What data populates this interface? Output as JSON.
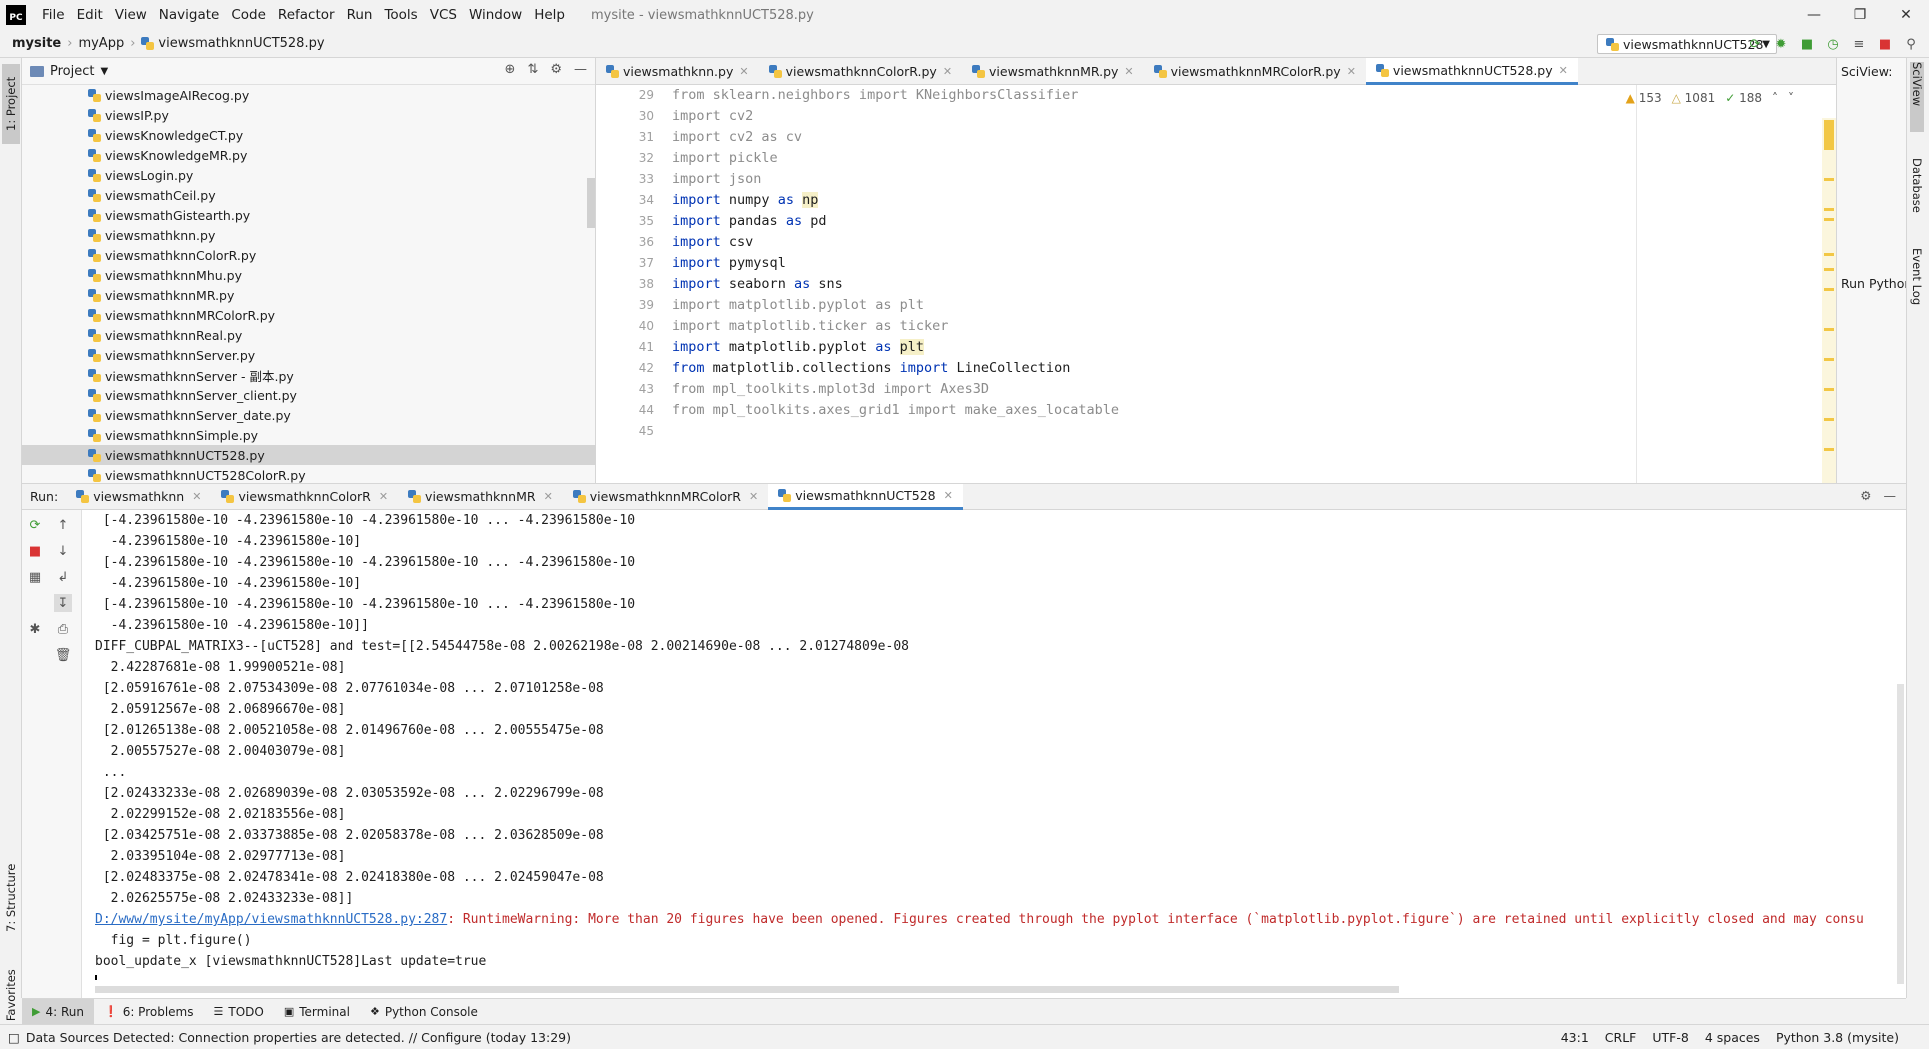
{
  "app": {
    "logo": "PC",
    "window_title": "mysite - viewsmathknnUCT528.py"
  },
  "menu": [
    "File",
    "Edit",
    "View",
    "Navigate",
    "Code",
    "Refactor",
    "Run",
    "Tools",
    "VCS",
    "Window",
    "Help"
  ],
  "breadcrumb": [
    "mysite",
    "myApp",
    "viewsmathknnUCT528.py"
  ],
  "run_config": "viewsmathknnUCT528",
  "left_tabs": {
    "project": "1: Project",
    "structure": "7: Structure",
    "favorites": "2: Favorites"
  },
  "right_tabs": {
    "sciview": "SciView",
    "database": "Database",
    "event_log": "Event Log"
  },
  "project": {
    "title": "Project",
    "files": [
      "viewsImageAIRecog.py",
      "viewsIP.py",
      "viewsKnowledgeCT.py",
      "viewsKnowledgeMR.py",
      "viewsLogin.py",
      "viewsmathCeil.py",
      "viewsmathGistearth.py",
      "viewsmathknn.py",
      "viewsmathknnColorR.py",
      "viewsmathknnMhu.py",
      "viewsmathknnMR.py",
      "viewsmathknnMRColorR.py",
      "viewsmathknnReal.py",
      "viewsmathknnServer.py",
      "viewsmathknnServer - 副本.py",
      "viewsmathknnServer_client.py",
      "viewsmathknnServer_date.py",
      "viewsmathknnSimple.py",
      "viewsmathknnUCT528.py",
      "viewsmathknnUCT528ColorR.py"
    ],
    "selected": "viewsmathknnUCT528.py"
  },
  "editor": {
    "tabs": [
      "viewsmathknn.py",
      "viewsmathknnColorR.py",
      "viewsmathknnMR.py",
      "viewsmathknnMRColorR.py",
      "viewsmathknnUCT528.py"
    ],
    "active_tab": "viewsmathknnUCT528.py",
    "inspection": {
      "warnings": "153",
      "weak_warnings": "1081",
      "typos": "188"
    },
    "lines": [
      {
        "n": "29",
        "t": "from sklearn.neighbors import KNeighborsClassifier"
      },
      {
        "n": "30",
        "t": "import cv2"
      },
      {
        "n": "31",
        "t": "import cv2 as cv"
      },
      {
        "n": "32",
        "t": "import pickle"
      },
      {
        "n": "33",
        "t": "import json"
      },
      {
        "n": "34",
        "t": "import numpy as np"
      },
      {
        "n": "35",
        "t": "import pandas as pd"
      },
      {
        "n": "36",
        "t": "import csv"
      },
      {
        "n": "37",
        "t": "import pymysql"
      },
      {
        "n": "38",
        "t": "import seaborn as sns"
      },
      {
        "n": "39",
        "t": "import matplotlib.pyplot as plt"
      },
      {
        "n": "40",
        "t": "import matplotlib.ticker as ticker"
      },
      {
        "n": "41",
        "t": "import matplotlib.pyplot as plt"
      },
      {
        "n": "42",
        "t": "from matplotlib.collections import LineCollection"
      },
      {
        "n": "43",
        "t": "from mpl_toolkits.mplot3d import Axes3D"
      },
      {
        "n": "44",
        "t": "from mpl_toolkits.axes_grid1 import make_axes_locatable"
      },
      {
        "n": "45",
        "t": ""
      }
    ]
  },
  "sciview": {
    "title": "SciView:",
    "run_label": "Run Python C"
  },
  "run": {
    "label": "Run:",
    "tabs": [
      "viewsmathknn",
      "viewsmathknnColorR",
      "viewsmathknnMR",
      "viewsmathknnMRColorR",
      "viewsmathknnUCT528"
    ],
    "active_tab": "viewsmathknnUCT528",
    "output": [
      " [-4.23961580e-10 -4.23961580e-10 -4.23961580e-10 ... -4.23961580e-10",
      "  -4.23961580e-10 -4.23961580e-10]",
      " [-4.23961580e-10 -4.23961580e-10 -4.23961580e-10 ... -4.23961580e-10",
      "  -4.23961580e-10 -4.23961580e-10]",
      " [-4.23961580e-10 -4.23961580e-10 -4.23961580e-10 ... -4.23961580e-10",
      "  -4.23961580e-10 -4.23961580e-10]]",
      "DIFF_CUBPAL_MATRIX3--[uCT528] and test=[[2.54544758e-08 2.00262198e-08 2.00214690e-08 ... 2.01274809e-08",
      "  2.42287681e-08 1.99900521e-08]",
      " [2.05916761e-08 2.07534309e-08 2.07761034e-08 ... 2.07101258e-08",
      "  2.05912567e-08 2.06896670e-08]",
      " [2.01265138e-08 2.00521058e-08 2.01496760e-08 ... 2.00555475e-08",
      "  2.00557527e-08 2.00403079e-08]",
      " ...",
      " [2.02433233e-08 2.02689039e-08 2.03053592e-08 ... 2.02296799e-08",
      "  2.02299152e-08 2.02183556e-08]",
      " [2.03425751e-08 2.03373885e-08 2.02058378e-08 ... 2.03628509e-08",
      "  2.03395104e-08 2.02977713e-08]",
      " [2.02483375e-08 2.02478341e-08 2.02418380e-08 ... 2.02459047e-08",
      "  2.02625575e-08 2.02433233e-08]]"
    ],
    "warning_link": "D:/www/mysite/myApp/viewsmathknnUCT528.py:287",
    "warning_text": ": RuntimeWarning: More than 20 figures have been opened. Figures created through the pyplot interface (`matplotlib.pyplot.figure`) are retained until explicitly closed and may consu",
    "fig_line": "  fig = plt.figure()",
    "last_line": "bool_update_x [viewsmathknnUCT528]Last update=true"
  },
  "bottom_tabs": [
    "4: Run",
    "6: Problems",
    "TODO",
    "Terminal",
    "Python Console"
  ],
  "status": {
    "message": "Data Sources Detected: Connection properties are detected. // Configure (today 13:29)",
    "position": "43:1",
    "line_sep": "CRLF",
    "encoding": "UTF-8",
    "indent": "4 spaces",
    "interpreter": "Python 3.8 (mysite)"
  }
}
